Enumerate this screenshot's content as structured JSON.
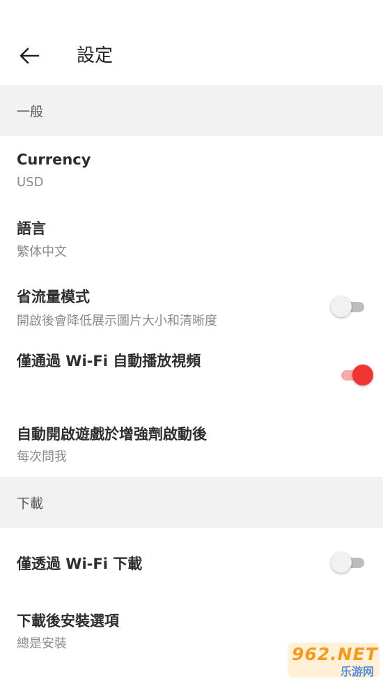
{
  "header": {
    "title": "設定",
    "back_icon": "arrow-left-icon"
  },
  "sections": [
    {
      "label": "一般"
    },
    {
      "label": "下載"
    }
  ],
  "general": {
    "currency": {
      "title": "Currency",
      "value": "USD"
    },
    "language": {
      "title": "語言",
      "value": "繁体中文"
    },
    "data_saver": {
      "title": "省流量模式",
      "subtitle": "開啟後會降低展示圖片大小和清晰度",
      "enabled": false
    },
    "wifi_autoplay": {
      "title": "僅通過 Wi-Fi 自動播放視頻",
      "enabled": true
    },
    "auto_open_game": {
      "title": "自動開啟遊戲於增強劑啟動後",
      "value": "每次問我"
    }
  },
  "download": {
    "wifi_only": {
      "title": "僅透過 Wi-Fi 下載",
      "enabled": false
    },
    "install_option": {
      "title": "下載後安裝選項",
      "value": "總是安裝"
    }
  },
  "colors": {
    "accent": "#f03434",
    "accent_track": "#f8a9a9",
    "section_bg": "#f2f2f2"
  },
  "watermark": {
    "main": "962.NET",
    "sub": "乐游网"
  }
}
